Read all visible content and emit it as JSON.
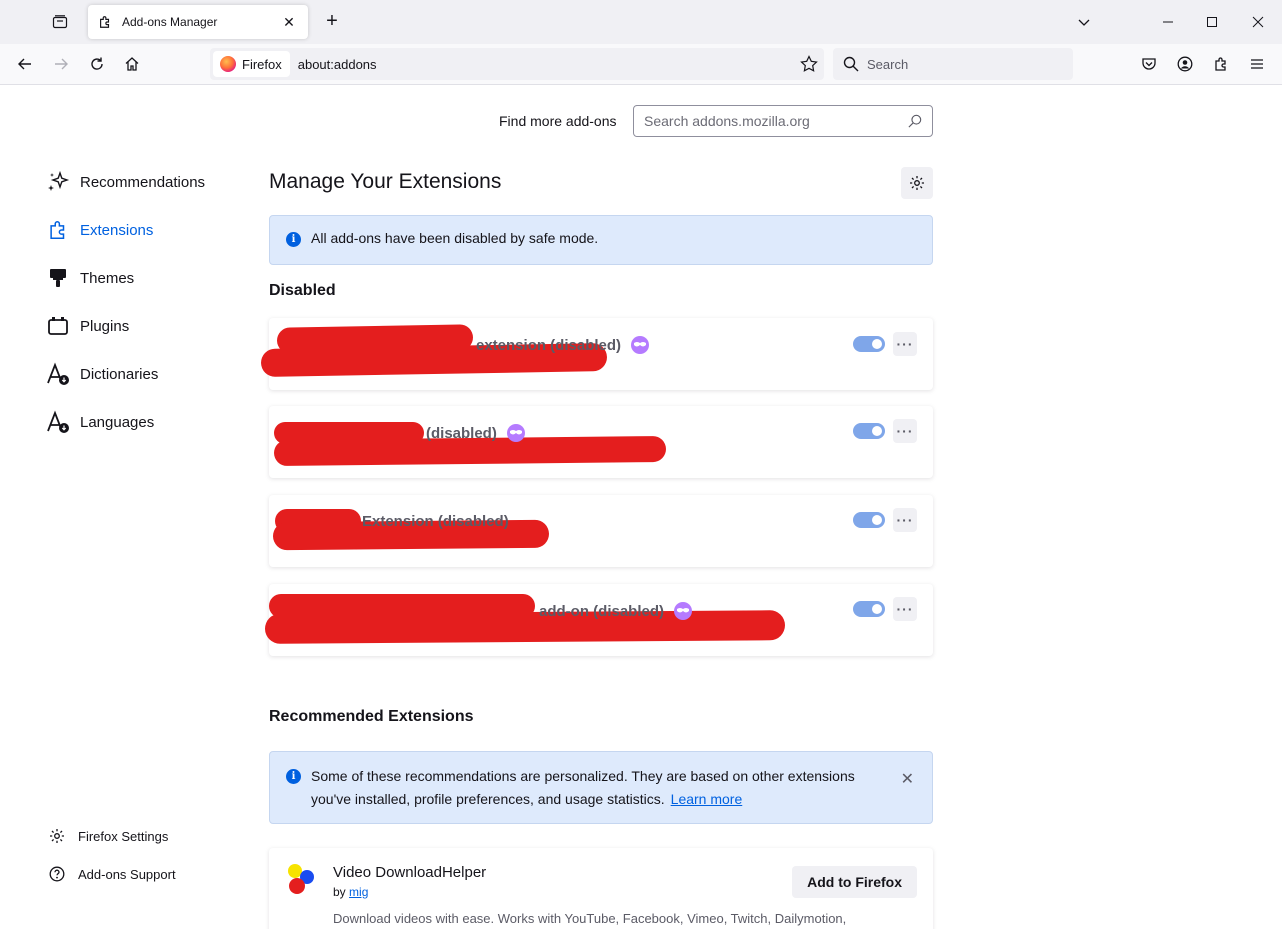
{
  "browser": {
    "tab_title": "Add-ons Manager",
    "identity_label": "Firefox",
    "url": "about:addons",
    "search_placeholder": "Search"
  },
  "header": {
    "find_more_label": "Find more add-ons",
    "amo_search_placeholder": "Search addons.mozilla.org"
  },
  "sidebar": {
    "items": [
      {
        "label": "Recommendations",
        "icon": "sparkle-icon"
      },
      {
        "label": "Extensions",
        "icon": "puzzle-icon",
        "active": true
      },
      {
        "label": "Themes",
        "icon": "brush-icon"
      },
      {
        "label": "Plugins",
        "icon": "plugin-icon"
      },
      {
        "label": "Dictionaries",
        "icon": "dictionary-icon"
      },
      {
        "label": "Languages",
        "icon": "language-icon"
      }
    ],
    "footer": [
      {
        "label": "Firefox Settings",
        "icon": "gear-icon"
      },
      {
        "label": "Add-ons Support",
        "icon": "help-icon"
      }
    ]
  },
  "main": {
    "title": "Manage Your Extensions",
    "safe_mode_message": "All add-ons have been disabled by safe mode.",
    "disabled_heading": "Disabled",
    "extensions": [
      {
        "name_visible": "extension (disabled)",
        "private": true,
        "enabled": true
      },
      {
        "name_visible": "(disabled)",
        "private": true,
        "enabled": true
      },
      {
        "name_visible": "Extension (disabled)",
        "private": false,
        "enabled": true
      },
      {
        "name_visible": "add-on (disabled)",
        "private": true,
        "enabled": true
      }
    ],
    "recommended_heading": "Recommended Extensions",
    "personalized_message": "Some of these recommendations are personalized. They are based on other extensions",
    "personalized_message_2": "you've installed, profile preferences, and usage statistics.",
    "learn_more": "Learn more",
    "recommendation": {
      "name": "Video DownloadHelper",
      "by_label": "by",
      "author": "mig",
      "button": "Add to Firefox",
      "description": "Download videos with ease. Works with YouTube, Facebook, Vimeo, Twitch, Dailymotion,"
    }
  },
  "colors": {
    "accent": "#0061e0",
    "info_bg": "#deeafc",
    "toggle": "#7fa6e9",
    "redaction": "#e41e1e",
    "private_badge": "#b57bff"
  }
}
